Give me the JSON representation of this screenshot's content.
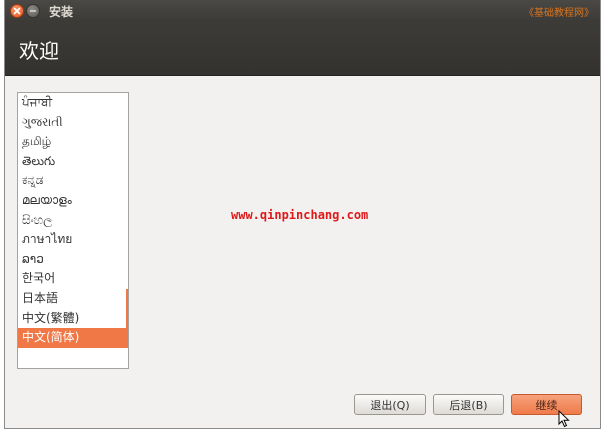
{
  "window": {
    "title": "安装",
    "watermark": "《基础教程网》"
  },
  "header": {
    "title": "欢迎"
  },
  "languages": {
    "items": [
      {
        "label": "ਪੰਜਾਬੀ",
        "selected": false
      },
      {
        "label": "ગુજરાતી",
        "selected": false
      },
      {
        "label": "தமிழ்",
        "selected": false
      },
      {
        "label": "తెలుగు",
        "selected": false
      },
      {
        "label": "ಕನ್ನಡ",
        "selected": false
      },
      {
        "label": "മലയാളം",
        "selected": false
      },
      {
        "label": "සිංහල",
        "selected": false
      },
      {
        "label": "ภาษาไทย",
        "selected": false
      },
      {
        "label": "ລາວ",
        "selected": false
      },
      {
        "label": "한국어",
        "selected": false
      },
      {
        "label": "日本語",
        "selected": false
      },
      {
        "label": "中文(繁體)",
        "selected": false
      },
      {
        "label": "中文(简体)",
        "selected": true
      }
    ]
  },
  "center": {
    "text": "www.qinpinchang.com"
  },
  "buttons": {
    "quit": "退出(Q)",
    "back": "后退(B)",
    "continue": "继续"
  },
  "colors": {
    "accent": "#f07746",
    "header_bg": "#3c3b37",
    "watermark": "#d8741f",
    "center_text": "#e01818"
  }
}
